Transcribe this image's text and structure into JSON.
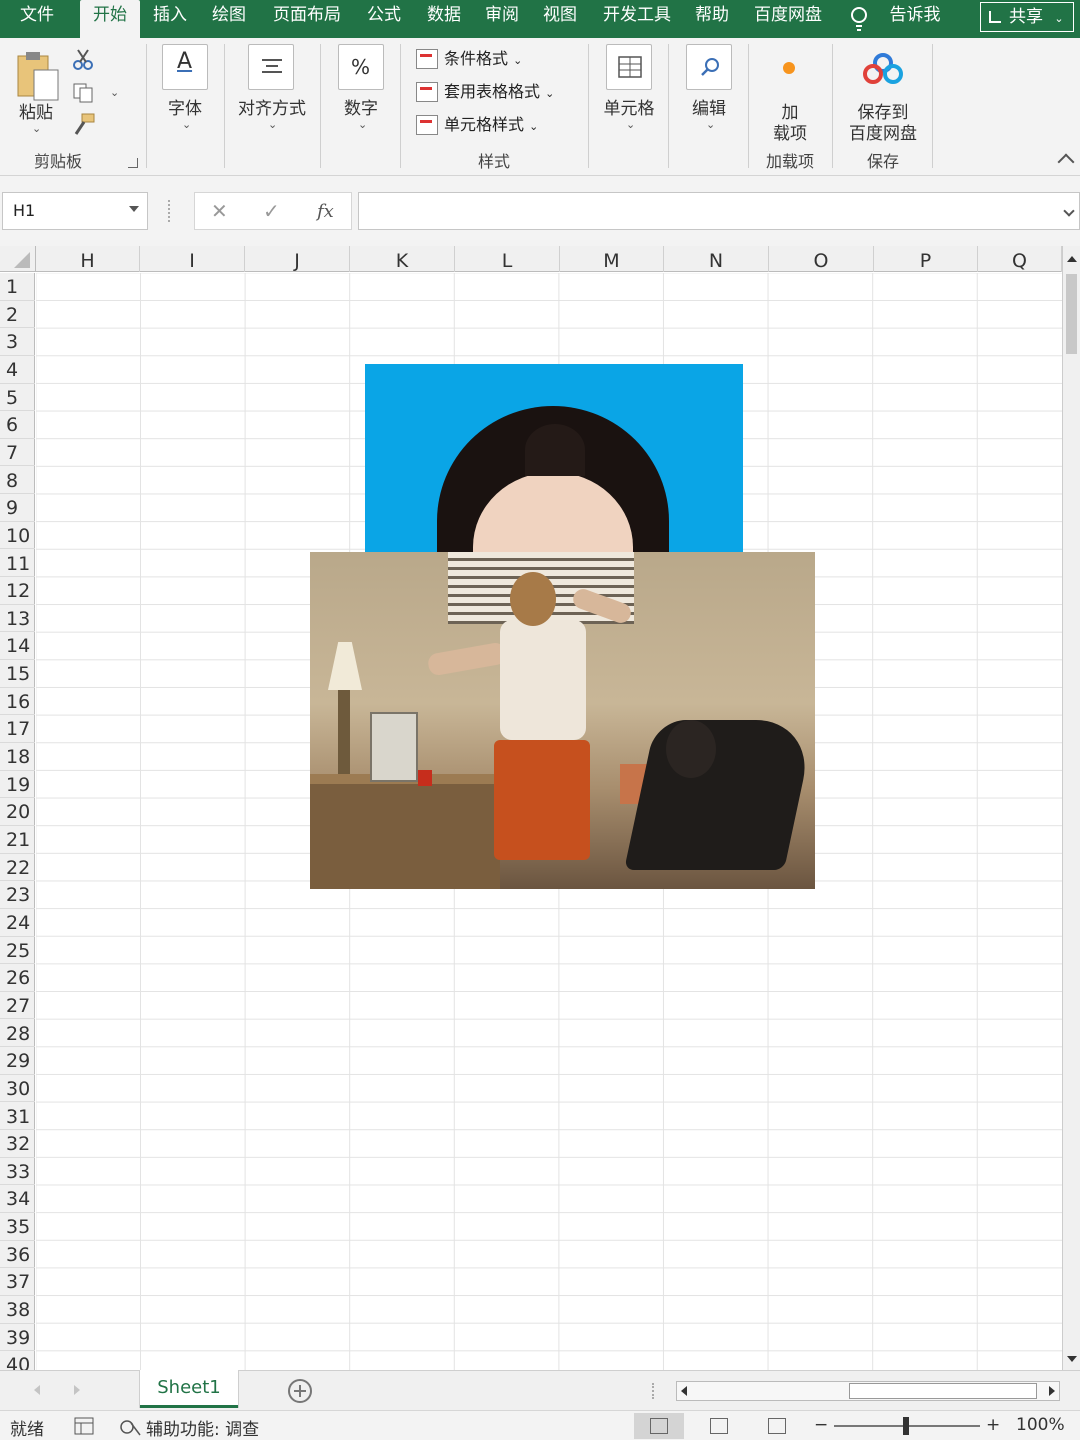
{
  "tabs": {
    "file": "文件",
    "home": "开始",
    "insert": "插入",
    "draw": "绘图",
    "page_layout": "页面布局",
    "formulas": "公式",
    "data": "数据",
    "review": "审阅",
    "view": "视图",
    "developer": "开发工具",
    "help": "帮助",
    "baidu_pan": "百度网盘",
    "tell_me": "告诉我",
    "share": "共享"
  },
  "ribbon": {
    "paste": "粘贴",
    "clipboard": "剪贴板",
    "font": "字体",
    "alignment": "对齐方式",
    "number": "数字",
    "number_glyph": "%",
    "conditional_formatting": "条件格式",
    "format_as_table": "套用表格格式",
    "cell_styles": "单元格样式",
    "styles": "样式",
    "cells": "单元格",
    "editing": "编辑",
    "addins_line1": "加",
    "addins_line2": "载项",
    "addins_group": "加载项",
    "save_to_line1": "保存到",
    "save_to_line2": "百度网盘",
    "save_group": "保存"
  },
  "formula_bar": {
    "name_box": "H1",
    "fx": "fx",
    "cancel": "✕",
    "enter": "✓",
    "value": ""
  },
  "columns": [
    "H",
    "I",
    "J",
    "K",
    "L",
    "M",
    "N",
    "O",
    "P",
    "Q"
  ],
  "rows": [
    "1",
    "2",
    "3",
    "4",
    "5",
    "6",
    "7",
    "8",
    "9",
    "10",
    "11",
    "12",
    "13",
    "14",
    "15",
    "16",
    "17",
    "18",
    "19",
    "20",
    "21",
    "22",
    "23",
    "24",
    "25",
    "26",
    "27",
    "28",
    "29",
    "30",
    "31",
    "32",
    "33",
    "34",
    "35",
    "36",
    "37",
    "38",
    "39",
    "40"
  ],
  "sheet": {
    "tab_name": "Sheet1"
  },
  "status": {
    "ready": "就绪",
    "accessibility": "辅助功能: 调查",
    "zoom_minus": "−",
    "zoom_plus": "+",
    "zoom": "100%"
  },
  "colors": {
    "brand_green": "#217346",
    "portrait_bg": "#0aa5e6"
  }
}
